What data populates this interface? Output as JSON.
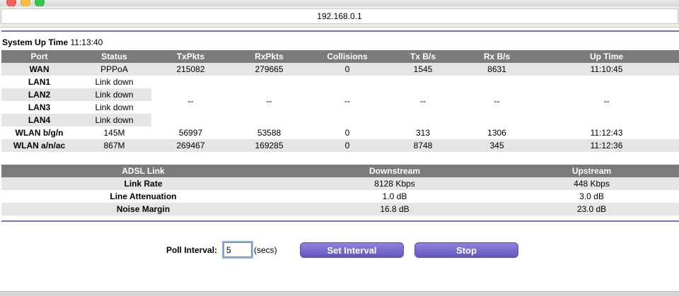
{
  "browser": {
    "address": "192.168.0.1"
  },
  "system": {
    "uptime_label": "System Up Time",
    "uptime_value": "11:13:40"
  },
  "port_table": {
    "headers": [
      "Port",
      "Status",
      "TxPkts",
      "RxPkts",
      "Collisions",
      "Tx B/s",
      "Rx B/s",
      "Up Time"
    ],
    "wan": {
      "port": "WAN",
      "status": "PPPoA",
      "txpkts": "215082",
      "rxpkts": "279665",
      "collisions": "0",
      "txbs": "1545",
      "rxbs": "8631",
      "uptime": "11:10:45"
    },
    "lan": [
      {
        "port": "LAN1",
        "status": "Link down"
      },
      {
        "port": "LAN2",
        "status": "Link down"
      },
      {
        "port": "LAN3",
        "status": "Link down"
      },
      {
        "port": "LAN4",
        "status": "Link down"
      }
    ],
    "lan_shared": {
      "txpkts": "--",
      "rxpkts": "--",
      "collisions": "--",
      "txbs": "--",
      "rxbs": "--",
      "uptime": "--"
    },
    "wlan_bgn": {
      "port": "WLAN b/g/n",
      "status": "145M",
      "txpkts": "56997",
      "rxpkts": "53588",
      "collisions": "0",
      "txbs": "313",
      "rxbs": "1306",
      "uptime": "11:12:43"
    },
    "wlan_anac": {
      "port": "WLAN a/n/ac",
      "status": "867M",
      "txpkts": "269467",
      "rxpkts": "169285",
      "collisions": "0",
      "txbs": "8748",
      "rxbs": "345",
      "uptime": "11:12:36"
    }
  },
  "adsl_table": {
    "headers": [
      "ADSL Link",
      "Downstream",
      "Upstream"
    ],
    "rows": [
      {
        "label": "Link Rate",
        "down": "8128 Kbps",
        "up": "448 Kbps"
      },
      {
        "label": "Line Attenuation",
        "down": "1.0 dB",
        "up": "3.0 dB"
      },
      {
        "label": "Noise Margin",
        "down": "16.8 dB",
        "up": "23.0 dB"
      }
    ]
  },
  "poll": {
    "label": "Poll Interval:",
    "value": "5",
    "unit": "(secs)",
    "set_button": "Set Interval",
    "stop_button": "Stop"
  },
  "colors": {
    "accent": "#7b6fc6",
    "header_bg": "#7b7b7b",
    "row_shade": "#e5e5e5"
  }
}
